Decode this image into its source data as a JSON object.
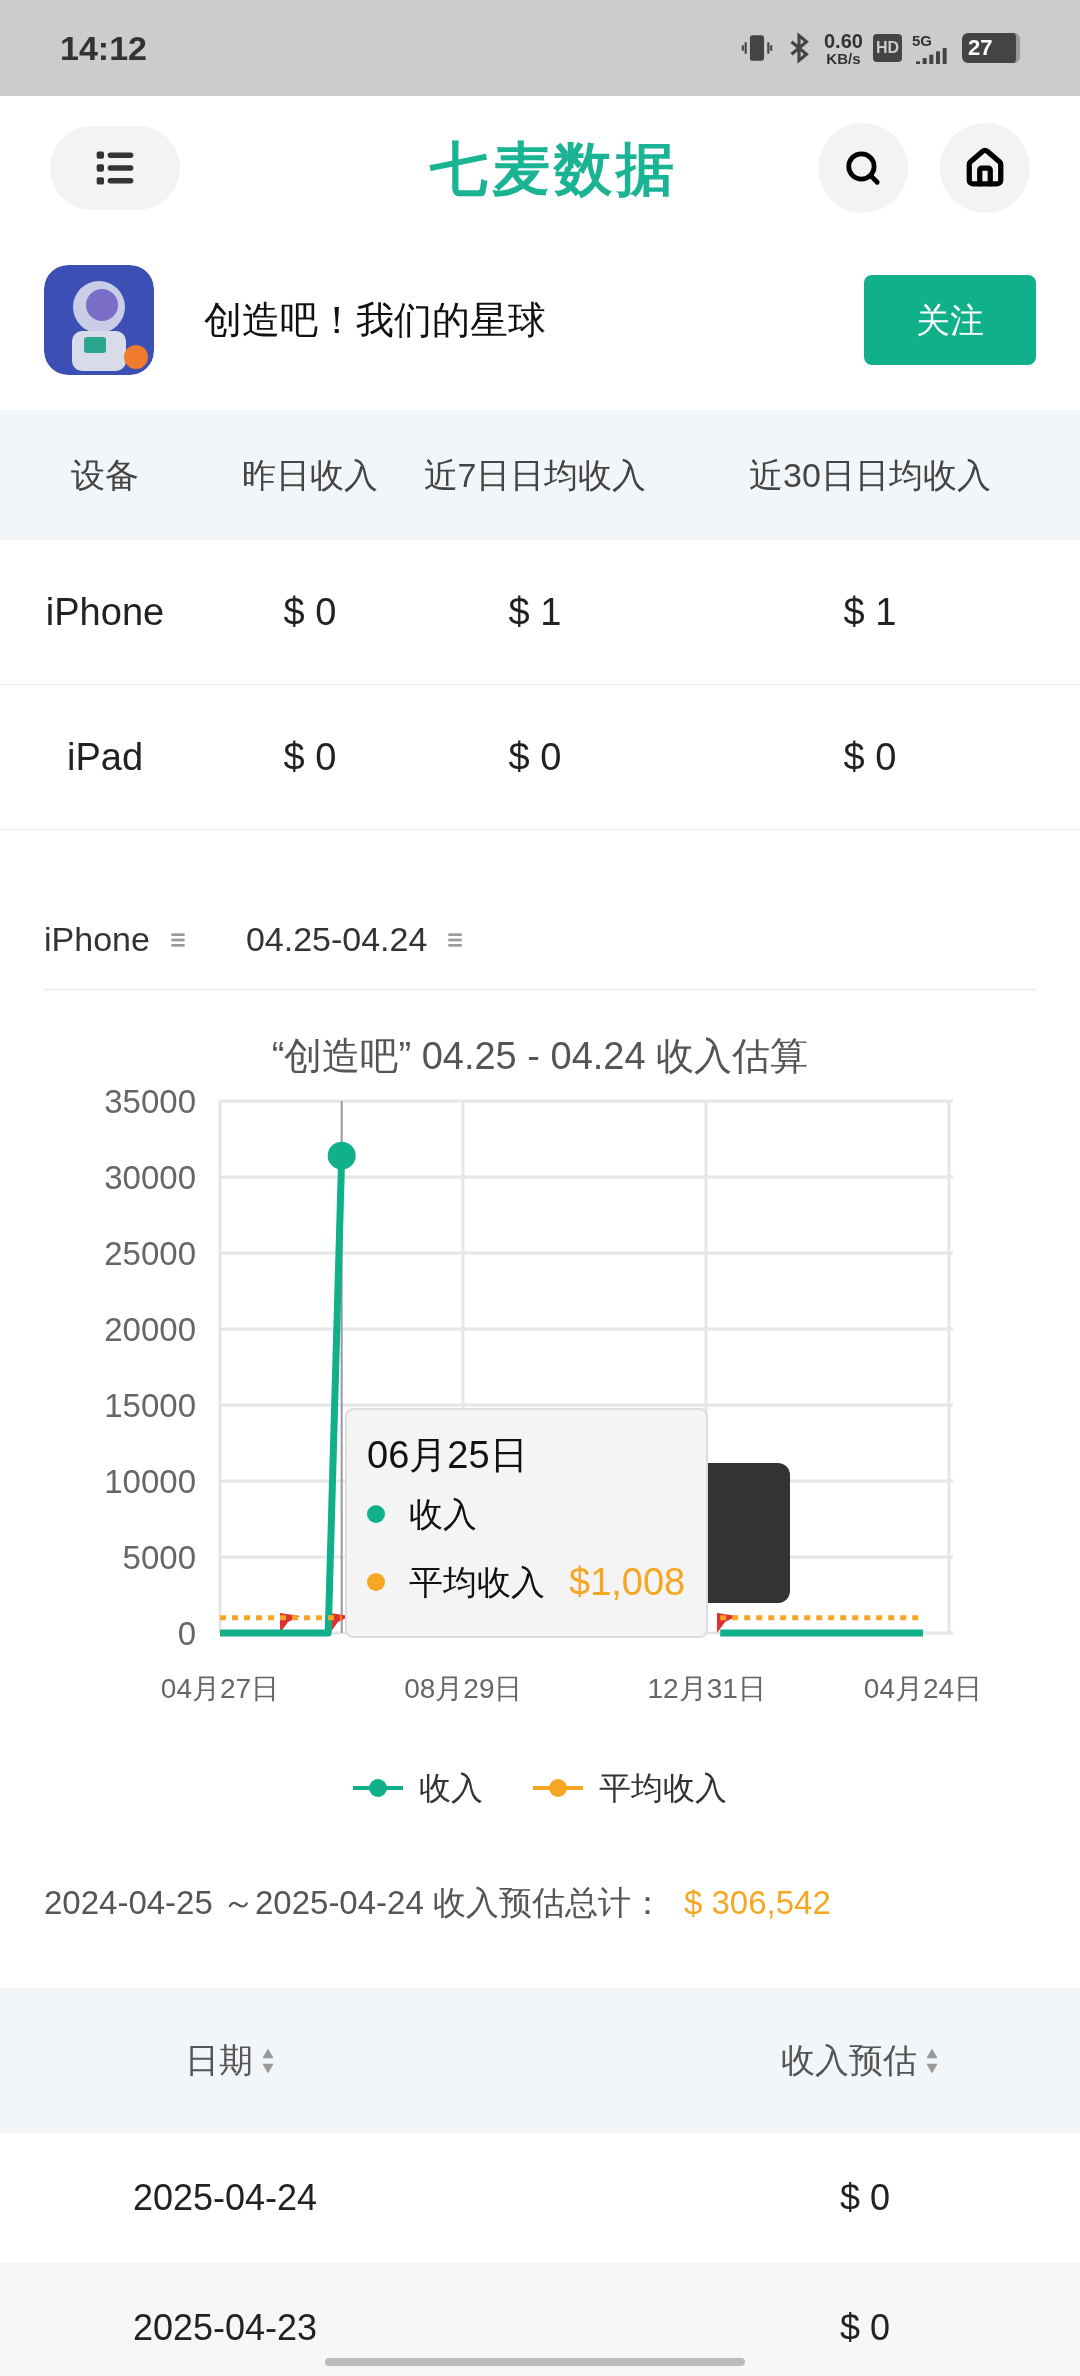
{
  "status_bar": {
    "time": "14:12",
    "speed_value": "0.60",
    "speed_unit": "KB/s",
    "hd": "HD",
    "network": "5G",
    "battery": "27"
  },
  "header": {
    "logo": "七麦数据"
  },
  "app": {
    "name": "创造吧！我们的星球",
    "follow_button": "关注"
  },
  "device_table": {
    "columns": [
      "设备",
      "昨日收入",
      "近7日日均收入",
      "近30日日均收入"
    ],
    "rows": [
      [
        "iPhone",
        "$ 0",
        "$ 1",
        "$ 1"
      ],
      [
        "iPad",
        "$ 0",
        "$ 0",
        "$ 0"
      ]
    ]
  },
  "filters": [
    {
      "label": "iPhone"
    },
    {
      "label": "04.25-04.24"
    }
  ],
  "chart": {
    "chart_data": {
      "type": "line",
      "title": "“创造吧” 04.25 - 04.24 收入估算",
      "categories": [
        "04月27日",
        null,
        null,
        null,
        null,
        null,
        null,
        null,
        null,
        null,
        null,
        null,
        null,
        null,
        null,
        null,
        null,
        null,
        "08月29日",
        null,
        null,
        null,
        null,
        null,
        null,
        null,
        null,
        null,
        null,
        null,
        null,
        null,
        null,
        null,
        null,
        null,
        "12月31日",
        null,
        null,
        null,
        null,
        null,
        null,
        null,
        null,
        null,
        null,
        null,
        null,
        null,
        null,
        null,
        "04月24日"
      ],
      "series": [
        {
          "name": "收入",
          "color": "#10b08a",
          "values": [
            0,
            0,
            0,
            0,
            0,
            0,
            0,
            0,
            0,
            31400,
            null,
            null,
            null,
            null,
            null,
            null,
            null,
            null,
            null,
            null,
            null,
            null,
            null,
            null,
            null,
            null,
            null,
            null,
            null,
            null,
            null,
            null,
            null,
            null,
            null,
            null,
            null,
            0,
            0,
            0,
            0,
            0,
            0,
            0,
            0,
            0,
            0,
            0,
            0,
            0,
            0,
            0,
            0
          ]
        },
        {
          "name": "平均收入",
          "color": "#f5a623",
          "line_style": "dotted",
          "values": [
            1008,
            1008,
            1008,
            1008,
            1008,
            1008,
            1008,
            1008,
            1008,
            1008,
            null,
            null,
            null,
            null,
            null,
            null,
            null,
            null,
            null,
            null,
            null,
            null,
            null,
            null,
            null,
            null,
            null,
            null,
            null,
            null,
            null,
            null,
            null,
            null,
            null,
            null,
            null,
            1008,
            1008,
            1008,
            1008,
            1008,
            1008,
            1008,
            1008,
            1008,
            1008,
            1008,
            1008,
            1008,
            1008,
            1008,
            1008
          ]
        }
      ],
      "ylim": [
        0,
        35000
      ],
      "grid": true,
      "legend": true,
      "yticks": [
        0,
        5000,
        10000,
        15000,
        20000,
        25000,
        30000,
        35000
      ]
    },
    "tooltip": {
      "date": "06月25日",
      "rows": [
        {
          "name": "收入",
          "color": "#10b08a",
          "value": ""
        },
        {
          "name": "平均收入",
          "color": "#f5a623",
          "value": "$1,008"
        }
      ]
    }
  },
  "total": {
    "label": "2024-04-25 ～2025-04-24 收入预估总计：",
    "value": "$ 306,542"
  },
  "daily_table": {
    "columns": [
      "日期",
      "收入预估"
    ],
    "rows": [
      [
        "2025-04-24",
        "$ 0"
      ],
      [
        "2025-04-23",
        "$ 0"
      ]
    ]
  }
}
